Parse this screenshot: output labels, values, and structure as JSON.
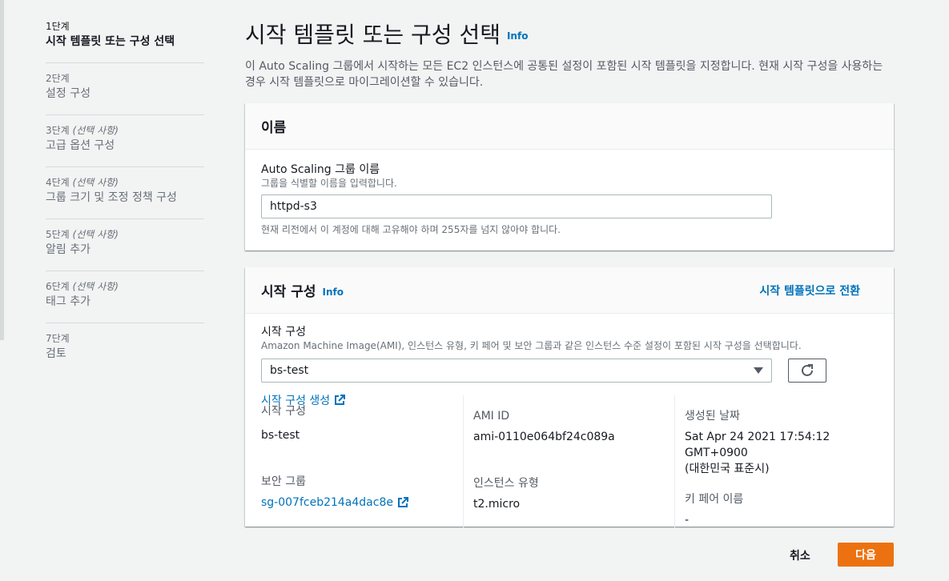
{
  "nav": {
    "steps": [
      {
        "num": "1단계",
        "optional": "",
        "title": "시작 템플릿 또는 구성 선택"
      },
      {
        "num": "2단계",
        "optional": "",
        "title": "설정 구성"
      },
      {
        "num": "3단계",
        "optional": "(선택 사항)",
        "title": "고급 옵션 구성"
      },
      {
        "num": "4단계",
        "optional": "(선택 사항)",
        "title": "그룹 크기 및 조정 정책 구성"
      },
      {
        "num": "5단계",
        "optional": "(선택 사항)",
        "title": "알림 추가"
      },
      {
        "num": "6단계",
        "optional": "(선택 사항)",
        "title": "태그 추가"
      },
      {
        "num": "7단계",
        "optional": "",
        "title": "검토"
      }
    ]
  },
  "page": {
    "title": "시작 템플릿 또는 구성 선택",
    "info": "Info",
    "description": "이 Auto Scaling 그룹에서 시작하는 모든 EC2 인스턴스에 공통된 설정이 포함된 시작 템플릿을 지정합니다. 현재 시작 구성을 사용하는 경우 시작 템플릿으로 마이그레이션할 수 있습니다."
  },
  "name_panel": {
    "heading": "이름",
    "field_label": "Auto Scaling 그룹 이름",
    "field_hint": "그룹을 식별할 이름을 입력합니다.",
    "value": "httpd-s3",
    "constraint": "현재 리전에서 이 계정에 대해 고유해야 하며 255자를 넘지 않아야 합니다."
  },
  "config_panel": {
    "heading": "시작 구성",
    "info": "Info",
    "switch_link": "시작 템플릿으로 전환",
    "field_label": "시작 구성",
    "field_hint": "Amazon Machine Image(AMI), 인스턴스 유형, 키 페어 및 보안 그룹과 같은 인스턴스 수준 설정이 포함된 시작 구성을 선택합니다.",
    "selected": "bs-test",
    "create_link": "시작 구성 생성",
    "details": {
      "config_label": "시작 구성",
      "config_value": "bs-test",
      "ami_label": "AMI ID",
      "ami_value": "ami-0110e064bf24c089a",
      "created_label": "생성된 날짜",
      "created_value_line1": "Sat Apr 24 2021 17:54:12 GMT+0900",
      "created_value_line2": "(대한민국 표준시)",
      "sg_label": "보안 그룹",
      "sg_value": "sg-007fceb214a4dac8e",
      "type_label": "인스턴스 유형",
      "type_value": "t2.micro",
      "key_label": "키 페어 이름",
      "key_value": "-"
    }
  },
  "footer": {
    "cancel": "취소",
    "next": "다음"
  },
  "colors": {
    "accent": "#0073bb",
    "primary_button": "#ec7211"
  }
}
